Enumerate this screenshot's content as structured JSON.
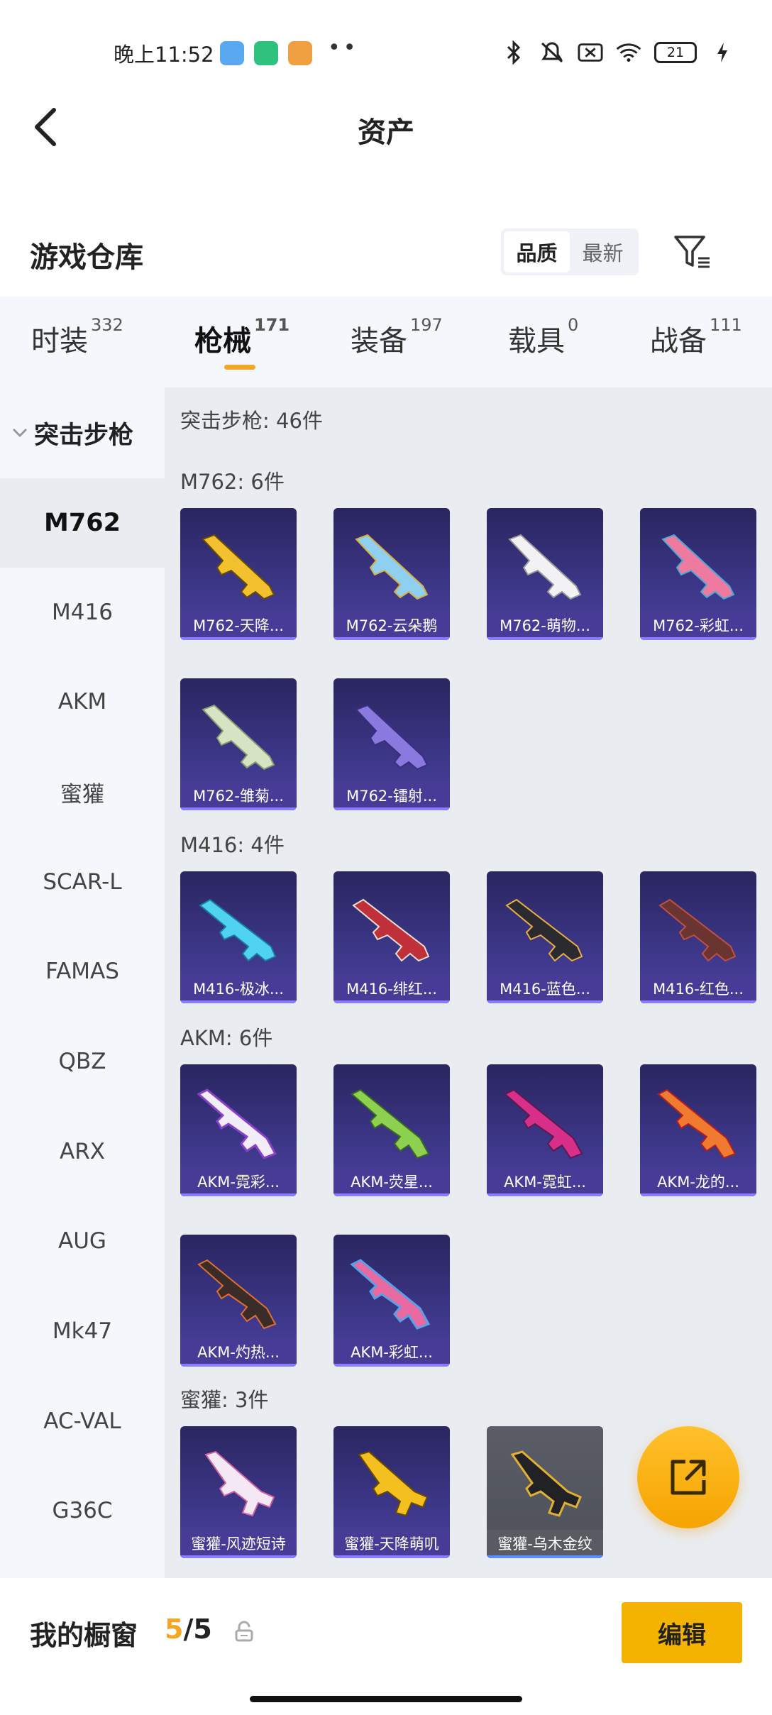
{
  "status_bar": {
    "time": "晚上11:52",
    "battery": "21",
    "icons": [
      "bluetooth-icon",
      "mute-icon",
      "sim-off-icon",
      "wifi-icon",
      "battery-icon",
      "charging-icon"
    ]
  },
  "header": {
    "title": "资产"
  },
  "warehouse": {
    "title": "游戏仓库",
    "sort_options": [
      "品质",
      "最新"
    ],
    "sort_active": "品质"
  },
  "category_tabs": [
    {
      "label": "时装",
      "count": "332"
    },
    {
      "label": "枪械",
      "count": "171",
      "active": true
    },
    {
      "label": "装备",
      "count": "197"
    },
    {
      "label": "载具",
      "count": "0"
    },
    {
      "label": "战备",
      "count": "111"
    }
  ],
  "sidebar": {
    "group": "突击步枪",
    "items": [
      "M762",
      "M416",
      "AKM",
      "蜜獾",
      "SCAR-L",
      "FAMAS",
      "QBZ",
      "ARX",
      "AUG",
      "Mk47",
      "AC-VAL",
      "G36C"
    ],
    "active": "M762"
  },
  "content": {
    "section_total": "突击步枪: 46件",
    "groups": [
      {
        "label": "M762: 6件",
        "items": [
          "M762-天降...",
          "M762-云朵鹅",
          "M762-萌物...",
          "M762-彩虹...",
          "M762-雏菊...",
          "M762-镭射..."
        ]
      },
      {
        "label": "M416: 4件",
        "items": [
          "M416-极冰...",
          "M416-绯红...",
          "M416-蓝色...",
          "M416-红色..."
        ]
      },
      {
        "label": "AKM: 6件",
        "items": [
          "AKM-霓彩...",
          "AKM-荧星...",
          "AKM-霓虹...",
          "AKM-龙的...",
          "AKM-灼热...",
          "AKM-彩虹..."
        ]
      },
      {
        "label": "蜜獾: 3件",
        "items": [
          "蜜獾-风迹短诗",
          "蜜獾-天降萌叽",
          "蜜獾-乌木金纹"
        ]
      }
    ]
  },
  "colors": {
    "accent": "#f5a623",
    "card_bg": "#3b3585",
    "card_gray": "#54575f",
    "edit_button": "#f5b301"
  },
  "bottom_bar": {
    "title": "我的橱窗",
    "count_current": "5",
    "count_sep": "/",
    "count_total": "5",
    "edit_label": "编辑"
  }
}
